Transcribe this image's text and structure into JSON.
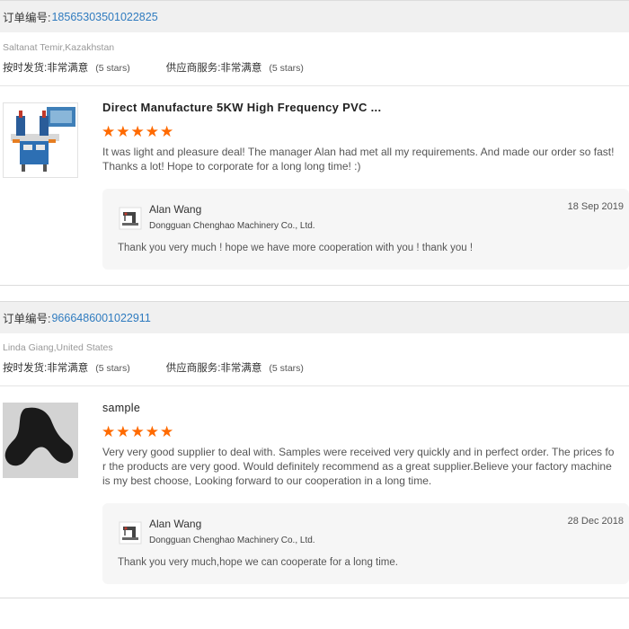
{
  "orders": [
    {
      "order_label": "订单编号:",
      "order_number": "18565303501022825",
      "buyer": "Saltanat Temir,Kazakhstan",
      "ratings": [
        {
          "label": "按时发货:",
          "value": "非常满意",
          "stars_text": "(5 stars)"
        },
        {
          "label": "供应商服务:",
          "value": "非常满意",
          "stars_text": "(5 stars)"
        }
      ],
      "product_title": "Direct Manufacture 5KW High Frequency PVC ...",
      "star_count": 5,
      "review": "It was light and pleasure deal! The manager Alan had met all my requirements. And made our order so fast! Thanks a lot! Hope to corporate for a long long time! :)",
      "reply": {
        "name": "Alan Wang",
        "company": "Dongguan Chenghao Machinery Co., Ltd.",
        "date": "18 Sep 2019",
        "text": "Thank you very  much ! hope we have more cooperation with you ! thank you !"
      }
    },
    {
      "order_label": "订单编号:",
      "order_number": "9666486001022911",
      "buyer": "Linda Giang,United States",
      "ratings": [
        {
          "label": "按时发货:",
          "value": "非常满意",
          "stars_text": "(5 stars)"
        },
        {
          "label": "供应商服务:",
          "value": "非常满意",
          "stars_text": "(5 stars)"
        }
      ],
      "product_title": "sample",
      "star_count": 5,
      "review": "Very very good supplier to deal with. Samples were received very quickly and in perfect order. The prices for the products are very good. Would definitely recommend as a great supplier.Believe your factory machine is my best choose, Looking forward to our cooperation in a long time.",
      "reply": {
        "name": "Alan Wang",
        "company": "Dongguan Chenghao Machinery Co., Ltd.",
        "date": "28 Dec 2018",
        "text": "Thank you very much,hope we can cooperate for a long time."
      }
    }
  ],
  "colors": {
    "star": "#ff6a00",
    "order_number": "#2f7bbf",
    "header_bg": "#f0f0f0",
    "reply_bg": "#f6f6f6"
  },
  "icons": {
    "star": "star-icon",
    "machine_logo": "sewing-machine-logo"
  }
}
